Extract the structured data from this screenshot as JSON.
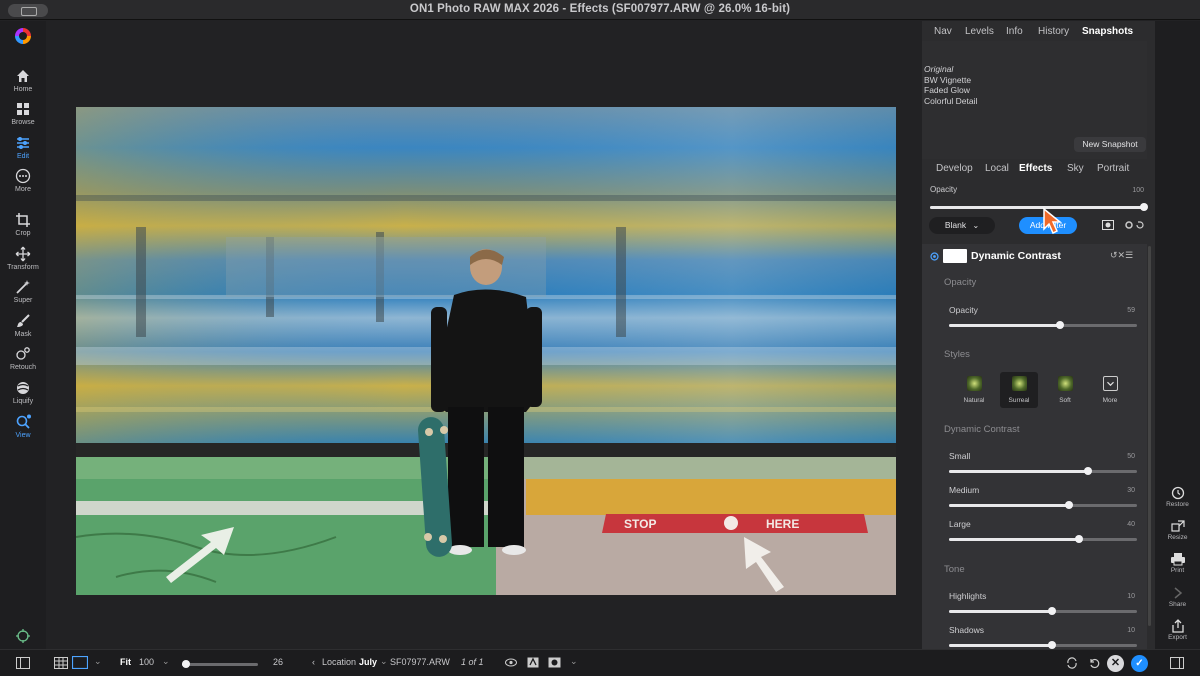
{
  "window": {
    "title": "ON1 Photo RAW MAX 2026 - Effects (SF007977.ARW @ 26.0% 16-bit)"
  },
  "left_tools": [
    {
      "label": "Home",
      "icon": "home-icon",
      "active": false
    },
    {
      "label": "Browse",
      "icon": "grid-icon",
      "active": false
    },
    {
      "label": "Edit",
      "icon": "sliders-icon",
      "active": true
    },
    {
      "label": "More",
      "icon": "more-icon",
      "active": false
    },
    {
      "label": "Crop",
      "icon": "crop-icon",
      "active": false
    },
    {
      "label": "Transform",
      "icon": "transform-icon",
      "active": false
    },
    {
      "label": "Super",
      "icon": "magic-wand-icon",
      "active": false
    },
    {
      "label": "Mask",
      "icon": "brush-icon",
      "active": false
    },
    {
      "label": "Retouch",
      "icon": "retouch-icon",
      "active": false
    },
    {
      "label": "Liquify",
      "icon": "liquify-icon",
      "active": false
    },
    {
      "label": "View",
      "icon": "zoom-icon",
      "active": true
    }
  ],
  "photo": {
    "sign_text": "STOP HERE",
    "colors": {
      "sky_blur": "#2f7fb3",
      "yellow_blur": "#c9b04a",
      "platform_green": "#5aa36b",
      "tactile_yellow": "#d8a63a",
      "paving": "#b9aaa3"
    }
  },
  "top_tabs": {
    "items": [
      "Nav",
      "Levels",
      "Info",
      "History",
      "Snapshots"
    ],
    "active": "Snapshots"
  },
  "snapshots": {
    "items": [
      "Original",
      "BW Vignette",
      "Faded Glow",
      "Colorful Detail"
    ],
    "new_button": "New Snapshot"
  },
  "module_tabs": {
    "items": [
      "Develop",
      "Local",
      "Effects",
      "Sky",
      "Portrait"
    ],
    "active": "Effects"
  },
  "layer_opacity": {
    "label": "Opacity",
    "value": "100",
    "fraction": 1.0
  },
  "preset_dropdown": {
    "value": "Blank"
  },
  "add_filter_button": {
    "label": "Add Filter",
    "accent": "#1f8fff"
  },
  "filter": {
    "name": "Dynamic Contrast",
    "sections": {
      "opacity_header": "Opacity",
      "styles_header": "Styles",
      "dc_header": "Dynamic Contrast",
      "tone_header": "Tone"
    },
    "opacity_slider": {
      "label": "Opacity",
      "value": "59",
      "fraction": 0.59
    },
    "styles": [
      {
        "label": "Natural",
        "selected": false
      },
      {
        "label": "Surreal",
        "selected": true
      },
      {
        "label": "Soft",
        "selected": false
      },
      {
        "label": "More",
        "selected": false
      }
    ],
    "dc_sliders": [
      {
        "label": "Small",
        "value": "50",
        "fraction": 0.74
      },
      {
        "label": "Medium",
        "value": "30",
        "fraction": 0.64
      },
      {
        "label": "Large",
        "value": "40",
        "fraction": 0.69
      }
    ],
    "tone_sliders": [
      {
        "label": "Highlights",
        "value": "10",
        "fraction": 0.55
      },
      {
        "label": "Shadows",
        "value": "10",
        "fraction": 0.55
      }
    ]
  },
  "right_strip": [
    {
      "label": "Restore",
      "icon": "restore-icon"
    },
    {
      "label": "Resize",
      "icon": "resize-icon"
    },
    {
      "label": "Print",
      "icon": "print-icon"
    },
    {
      "label": "Share",
      "icon": "share-icon"
    },
    {
      "label": "Export",
      "icon": "export-icon"
    }
  ],
  "bottom_bar": {
    "fit_label": "Fit",
    "zoom_value": "100",
    "size_value": "26",
    "location_label": "Location",
    "location_value": "July",
    "filename": "SF07977.ARW",
    "count": "1 of 1",
    "size_fraction": 0.05
  }
}
